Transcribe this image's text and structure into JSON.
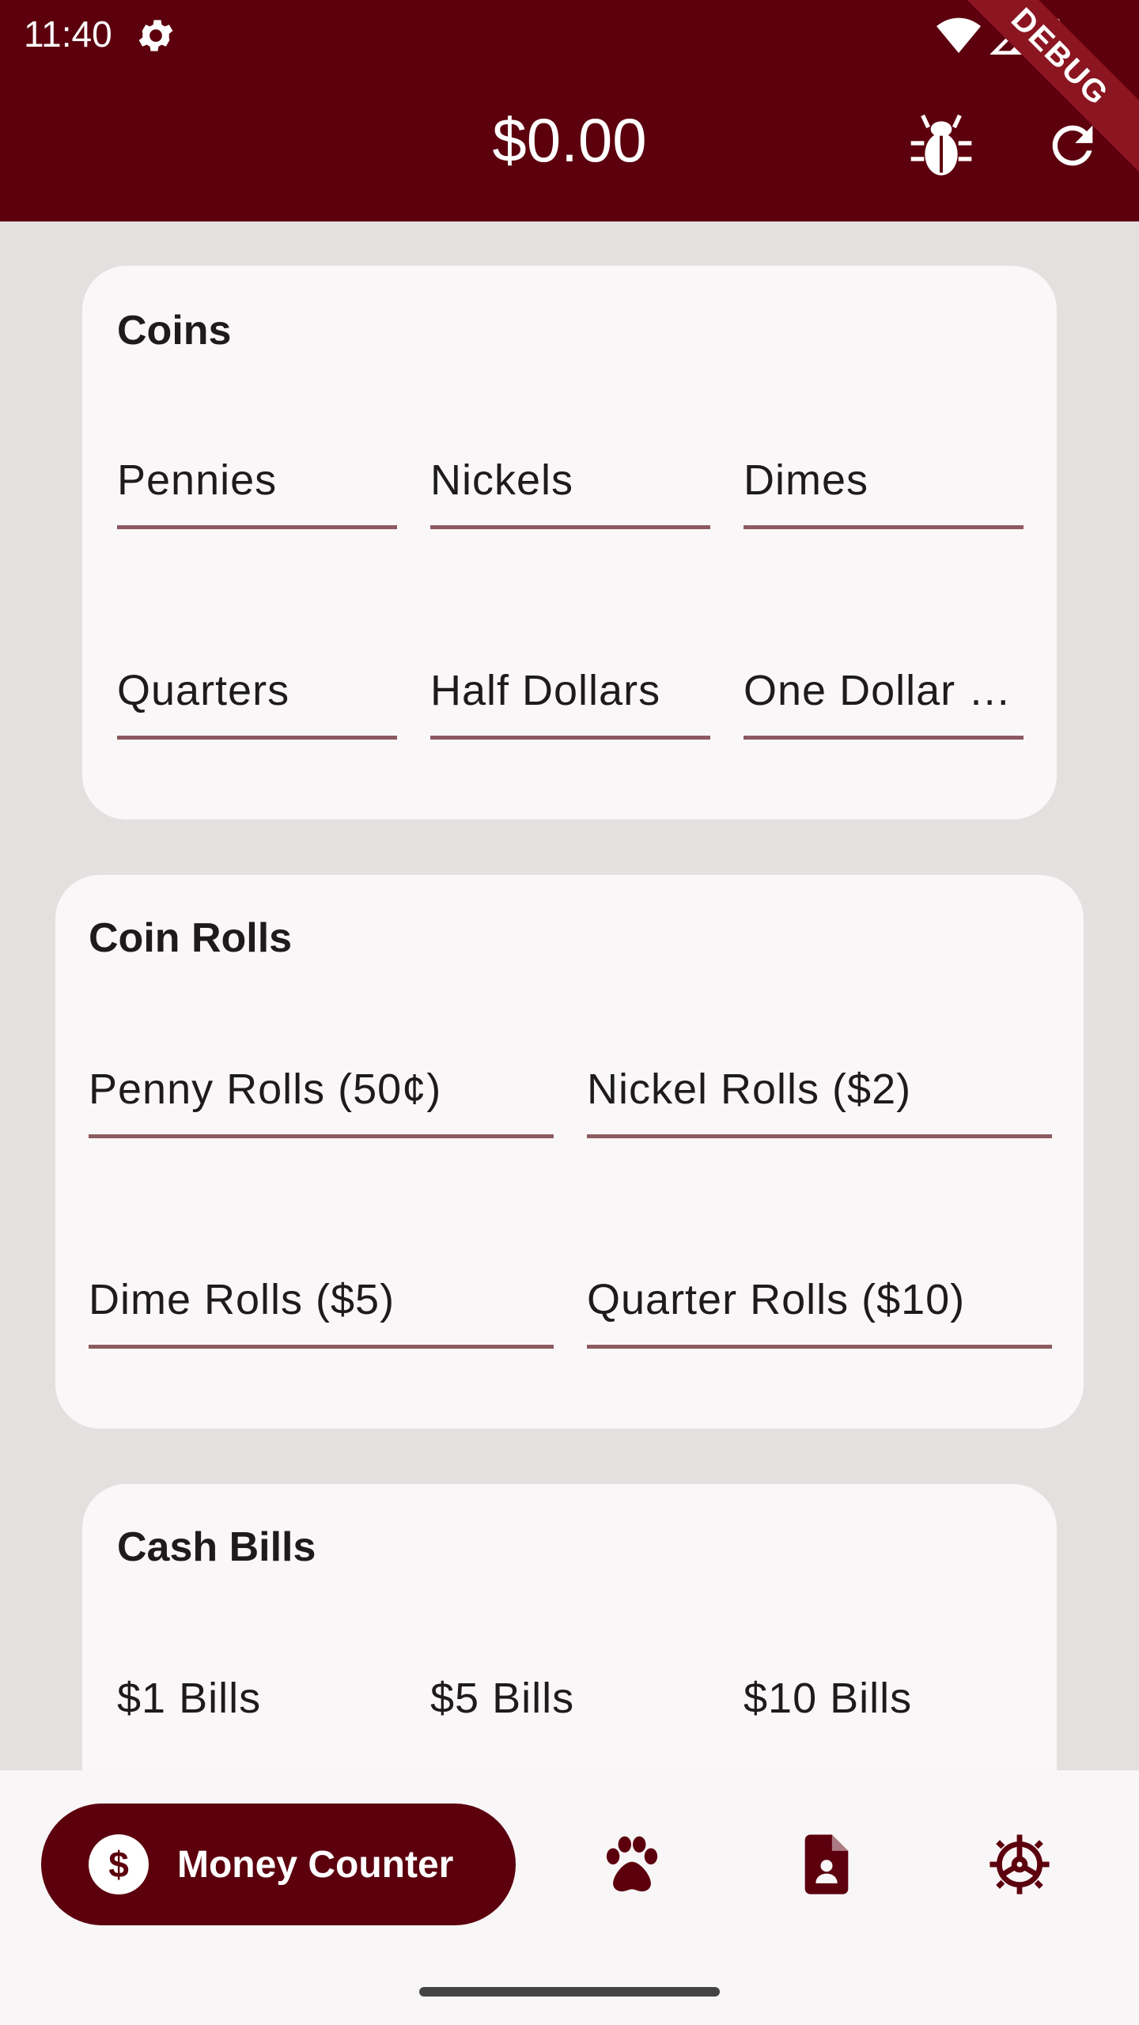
{
  "status": {
    "time": "11:40"
  },
  "header": {
    "title": "$0.00",
    "debug_banner": "DEBUG"
  },
  "coins": {
    "title": "Coins",
    "fields": [
      "Pennies",
      "Nickels",
      "Dimes",
      "Quarters",
      "Half Dollars",
      "One Dollar …"
    ]
  },
  "coin_rolls": {
    "title": "Coin Rolls",
    "fields": [
      "Penny Rolls (50¢)",
      "Nickel Rolls ($2)",
      "Dime Rolls ($5)",
      "Quarter Rolls ($10)"
    ]
  },
  "cash_bills": {
    "title": "Cash Bills",
    "fields": [
      "$1 Bills",
      "$5 Bills",
      "$10 Bills"
    ]
  },
  "nav": {
    "active_label": "Money Counter",
    "active_icon_glyph": "$",
    "icons": [
      "paw-icon",
      "document-icon",
      "settings-icon"
    ]
  },
  "colors": {
    "primary": "#5c000e",
    "surface": "#faf7f8",
    "background": "#e4e0e0",
    "underline": "#8c5a60"
  }
}
